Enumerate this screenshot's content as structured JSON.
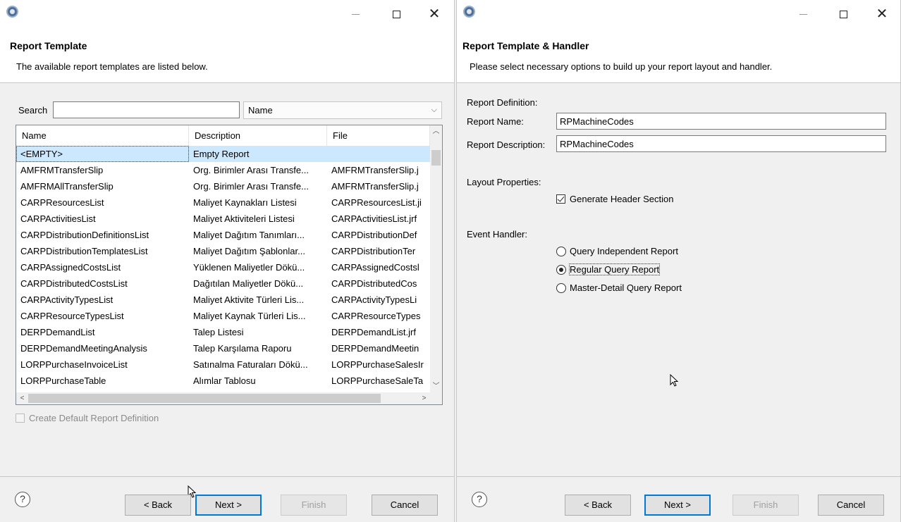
{
  "left": {
    "header": {
      "title": "Report Template",
      "description": "The available report templates are listed below."
    },
    "search": {
      "label": "Search",
      "value": "",
      "combo_value": "Name"
    },
    "table": {
      "columns": [
        "Name",
        "Description",
        "File"
      ],
      "rows": [
        [
          "<EMPTY>",
          "Empty Report",
          ""
        ],
        [
          "AMFRMTransferSlip",
          "Org. Birimler Arası Transfe...",
          "AMFRMTransferSlip.j"
        ],
        [
          "AMFRMAllTransferSlip",
          "Org. Birimler Arası Transfe...",
          "AMFRMTransferSlip.j"
        ],
        [
          "CARPResourcesList",
          "Maliyet Kaynakları Listesi",
          "CARPResourcesList.ji"
        ],
        [
          "CARPActivitiesList",
          "Maliyet Aktiviteleri Listesi",
          "CARPActivitiesList.jrf"
        ],
        [
          "CARPDistributionDefinitionsList",
          "Maliyet Dağıtım Tanımları...",
          "CARPDistributionDef"
        ],
        [
          "CARPDistributionTemplatesList",
          "Maliyet Dağıtım Şablonlar...",
          "CARPDistributionTer"
        ],
        [
          "CARPAssignedCostsList",
          "Yüklenen Maliyetler Dökü...",
          "CARPAssignedCostsl"
        ],
        [
          "CARPDistributedCostsList",
          "Dağıtılan Maliyetler Dökü...",
          "CARPDistributedCos"
        ],
        [
          "CARPActivityTypesList",
          "Maliyet Aktivite Türleri Lis...",
          "CARPActivityTypesLi"
        ],
        [
          "CARPResourceTypesList",
          "Maliyet Kaynak Türleri Lis...",
          "CARPResourceTypes"
        ],
        [
          "DERPDemandList",
          "Talep Listesi",
          "DERPDemandList.jrf"
        ],
        [
          "DERPDemandMeetingAnalysis",
          "Talep Karşılama Raporu",
          "DERPDemandMeetin"
        ],
        [
          "LORPPurchaseInvoiceList",
          "Satınalma Faturaları Dökü...",
          "LORPPurchaseSalesIr"
        ],
        [
          "LORPPurchaseTable",
          "Alımlar Tablosu",
          "LORPPurchaseSaleTa"
        ]
      ]
    },
    "checkbox_label": "Create Default Report Definition"
  },
  "right": {
    "header": {
      "title": "Report Template & Handler",
      "description": "Please select necessary options to build up your report layout and handler."
    },
    "report_definition_label": "Report Definition:",
    "report_name_label": "Report Name:",
    "report_name_value": "RPMachineCodes",
    "report_description_label": "Report Description:",
    "report_description_value": "RPMachineCodes",
    "layout_properties_label": "Layout Properties:",
    "generate_header_label": "Generate Header Section",
    "event_handler_label": "Event Handler:",
    "radio_options": [
      "Query Independent Report",
      "Regular Query Report",
      "Master-Detail Query Report"
    ],
    "selected_radio": "Regular Query Report"
  },
  "buttons": {
    "help": "?",
    "back": "< Back",
    "next": "Next >",
    "finish": "Finish",
    "cancel": "Cancel"
  },
  "colors": {
    "accent": "#0078d7",
    "selection": "#cce8ff",
    "close_mark": "#e81123"
  }
}
